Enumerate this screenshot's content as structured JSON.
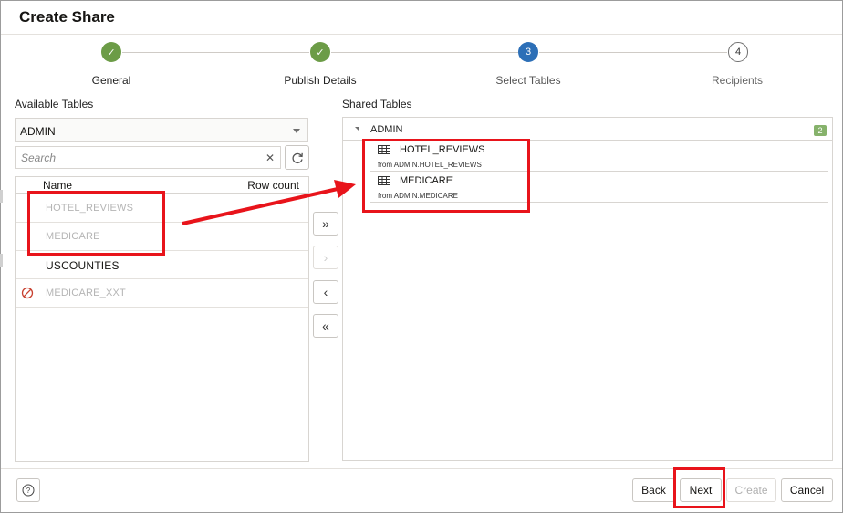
{
  "dialog": {
    "title": "Create Share"
  },
  "steps": [
    {
      "label": "General",
      "state": "done",
      "marker": "✓"
    },
    {
      "label": "Publish Details",
      "state": "done",
      "marker": "✓"
    },
    {
      "label": "Select Tables",
      "state": "current",
      "marker": "3"
    },
    {
      "label": "Recipients",
      "state": "upcoming",
      "marker": "4"
    }
  ],
  "available": {
    "heading": "Available Tables",
    "schema": "ADMIN",
    "search_placeholder": "Search",
    "columns": {
      "name": "Name",
      "row_count": "Row count"
    },
    "rows": [
      {
        "name": "HOTEL_REVIEWS",
        "state": "shared"
      },
      {
        "name": "MEDICARE",
        "state": "shared"
      },
      {
        "name": "USCOUNTIES",
        "state": "available"
      },
      {
        "name": "MEDICARE_XXT",
        "state": "not-allowed"
      }
    ]
  },
  "shuttle": {
    "move_all": "»",
    "move_selected": "›",
    "remove_selected": "‹",
    "remove_all": "«"
  },
  "shared": {
    "heading": "Shared Tables",
    "schema": "ADMIN",
    "count": "2",
    "items": [
      {
        "name": "HOTEL_REVIEWS",
        "source": "from ADMIN.HOTEL_REVIEWS"
      },
      {
        "name": "MEDICARE",
        "source": "from ADMIN.MEDICARE"
      }
    ]
  },
  "footer": {
    "back": "Back",
    "next": "Next",
    "create": "Create",
    "cancel": "Cancel"
  },
  "colors": {
    "step_done": "#6c9c47",
    "step_current": "#2c6fb7",
    "annotation": "#e8141b",
    "badge": "#86b26b"
  }
}
